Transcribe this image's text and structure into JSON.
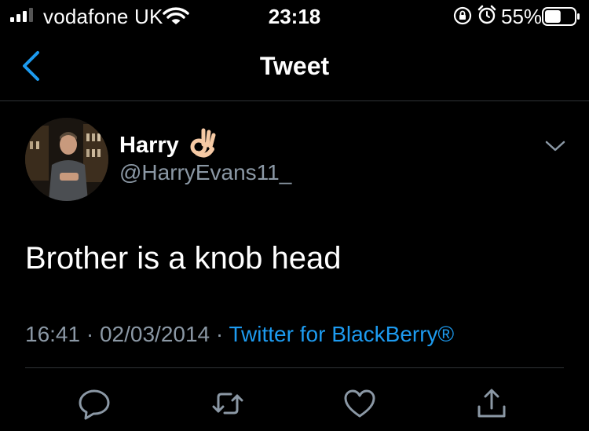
{
  "status_bar": {
    "carrier": "vodafone UK",
    "time": "23:18",
    "battery_percent": "55%",
    "battery_level": 0.55,
    "icons": [
      "signal-icon",
      "wifi-icon",
      "orientation-lock-icon",
      "alarm-icon",
      "battery-icon"
    ]
  },
  "nav": {
    "title": "Tweet",
    "back_icon": "chevron-left-icon"
  },
  "tweet": {
    "author_name": "Harry",
    "author_emoji": "ok-hand-emoji",
    "handle": "@HarryEvans11_",
    "text": "Brother is a knob head",
    "time": "16:41",
    "separator": "·",
    "date": "02/03/2014",
    "source": "Twitter for BlackBerry®"
  },
  "actions": [
    "reply-icon",
    "retweet-icon",
    "like-icon",
    "share-icon"
  ],
  "colors": {
    "background": "#000000",
    "text": "#ffffff",
    "secondary": "#8b98a5",
    "accent": "#1d9bf0",
    "divider": "#2f3336"
  }
}
